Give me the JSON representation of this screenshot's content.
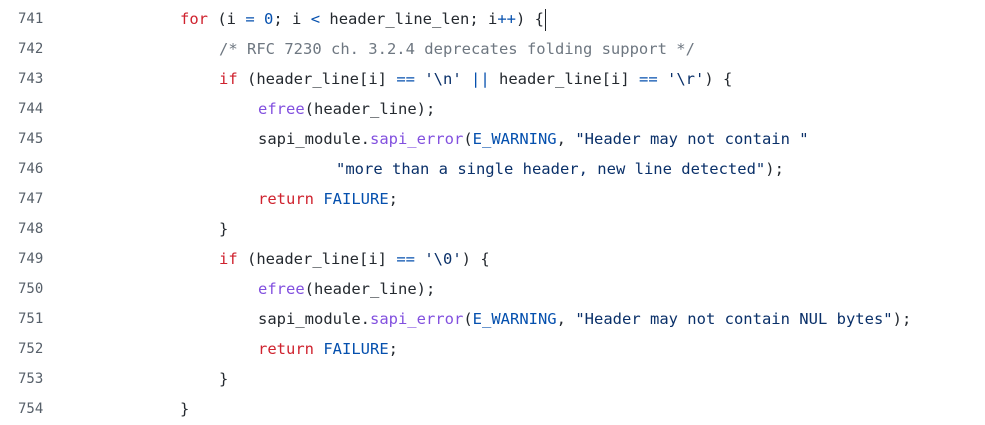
{
  "editor": {
    "lines": [
      {
        "number": "741",
        "indent": 0,
        "tokens": [
          {
            "t": "keyword",
            "v": "for"
          },
          {
            "t": "plain",
            "v": " (i "
          },
          {
            "t": "op",
            "v": "="
          },
          {
            "t": "plain",
            "v": " "
          },
          {
            "t": "number",
            "v": "0"
          },
          {
            "t": "plain",
            "v": "; i "
          },
          {
            "t": "op",
            "v": "<"
          },
          {
            "t": "plain",
            "v": " header_line_len; i"
          },
          {
            "t": "op",
            "v": "++"
          },
          {
            "t": "plain",
            "v": ") {"
          }
        ],
        "caret": true
      },
      {
        "number": "742",
        "indent": 1,
        "tokens": [
          {
            "t": "comment",
            "v": "/* RFC 7230 ch. 3.2.4 deprecates folding support */"
          }
        ]
      },
      {
        "number": "743",
        "indent": 1,
        "tokens": [
          {
            "t": "keyword",
            "v": "if"
          },
          {
            "t": "plain",
            "v": " (header_line[i] "
          },
          {
            "t": "op",
            "v": "=="
          },
          {
            "t": "plain",
            "v": " "
          },
          {
            "t": "string",
            "v": "'\\n'"
          },
          {
            "t": "plain",
            "v": " "
          },
          {
            "t": "op",
            "v": "||"
          },
          {
            "t": "plain",
            "v": " header_line[i] "
          },
          {
            "t": "op",
            "v": "=="
          },
          {
            "t": "plain",
            "v": " "
          },
          {
            "t": "string",
            "v": "'\\r'"
          },
          {
            "t": "plain",
            "v": ") {"
          }
        ]
      },
      {
        "number": "744",
        "indent": 2,
        "tokens": [
          {
            "t": "func",
            "v": "efree"
          },
          {
            "t": "plain",
            "v": "(header_line);"
          }
        ]
      },
      {
        "number": "745",
        "indent": 2,
        "tokens": [
          {
            "t": "plain",
            "v": "sapi_module."
          },
          {
            "t": "func",
            "v": "sapi_error"
          },
          {
            "t": "plain",
            "v": "("
          },
          {
            "t": "const",
            "v": "E_WARNING"
          },
          {
            "t": "plain",
            "v": ", "
          },
          {
            "t": "string",
            "v": "\"Header may not contain \""
          }
        ]
      },
      {
        "number": "746",
        "indent": 4,
        "tokens": [
          {
            "t": "string",
            "v": "\"more than a single header, new line detected\""
          },
          {
            "t": "plain",
            "v": ");"
          }
        ]
      },
      {
        "number": "747",
        "indent": 2,
        "tokens": [
          {
            "t": "keyword",
            "v": "return"
          },
          {
            "t": "plain",
            "v": " "
          },
          {
            "t": "const",
            "v": "FAILURE"
          },
          {
            "t": "plain",
            "v": ";"
          }
        ]
      },
      {
        "number": "748",
        "indent": 1,
        "tokens": [
          {
            "t": "plain",
            "v": "}"
          }
        ]
      },
      {
        "number": "749",
        "indent": 1,
        "tokens": [
          {
            "t": "keyword",
            "v": "if"
          },
          {
            "t": "plain",
            "v": " (header_line[i] "
          },
          {
            "t": "op",
            "v": "=="
          },
          {
            "t": "plain",
            "v": " "
          },
          {
            "t": "string",
            "v": "'\\0'"
          },
          {
            "t": "plain",
            "v": ") {"
          }
        ]
      },
      {
        "number": "750",
        "indent": 2,
        "tokens": [
          {
            "t": "func",
            "v": "efree"
          },
          {
            "t": "plain",
            "v": "(header_line);"
          }
        ]
      },
      {
        "number": "751",
        "indent": 2,
        "tokens": [
          {
            "t": "plain",
            "v": "sapi_module."
          },
          {
            "t": "func",
            "v": "sapi_error"
          },
          {
            "t": "plain",
            "v": "("
          },
          {
            "t": "const",
            "v": "E_WARNING"
          },
          {
            "t": "plain",
            "v": ", "
          },
          {
            "t": "string",
            "v": "\"Header may not contain NUL bytes\""
          },
          {
            "t": "plain",
            "v": ");"
          }
        ]
      },
      {
        "number": "752",
        "indent": 2,
        "tokens": [
          {
            "t": "keyword",
            "v": "return"
          },
          {
            "t": "plain",
            "v": " "
          },
          {
            "t": "const",
            "v": "FAILURE"
          },
          {
            "t": "plain",
            "v": ";"
          }
        ]
      },
      {
        "number": "753",
        "indent": 1,
        "tokens": [
          {
            "t": "plain",
            "v": "}"
          }
        ]
      },
      {
        "number": "754",
        "indent": 0,
        "tokens": [
          {
            "t": "plain",
            "v": "}"
          }
        ]
      }
    ]
  }
}
